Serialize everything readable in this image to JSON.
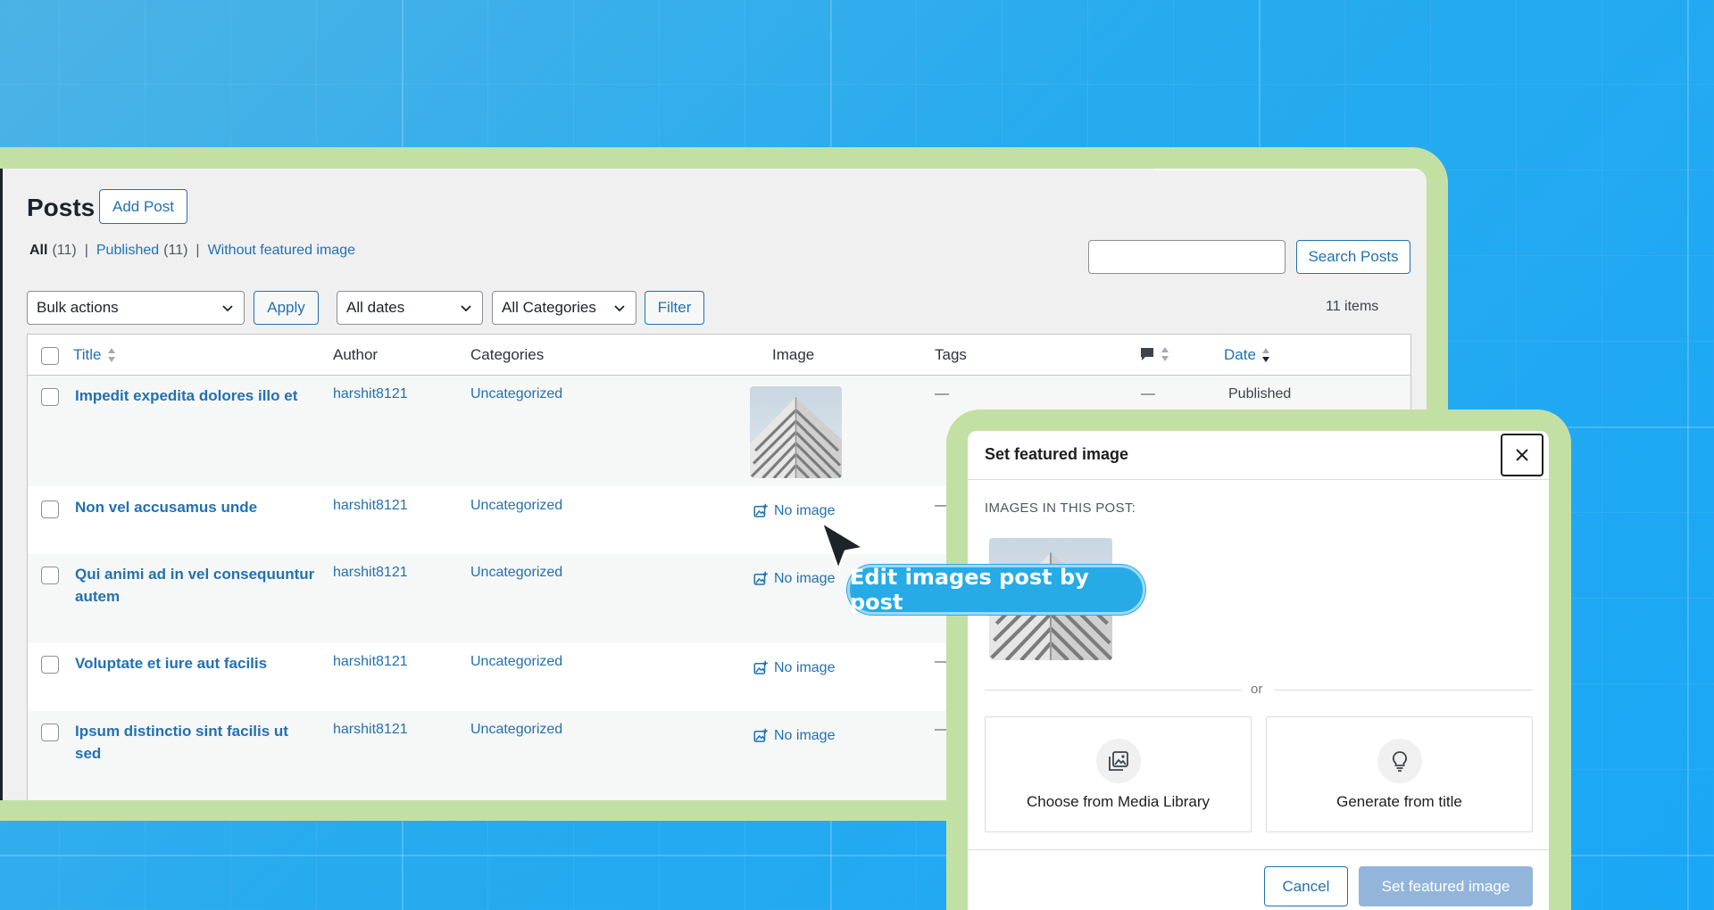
{
  "posts": {
    "title": "Posts",
    "add_label": "Add Post",
    "filters": {
      "all_label": "All",
      "all_count": "(11)",
      "published_label": "Published",
      "published_count": "(11)",
      "without_label": "Without featured image",
      "separator": "|"
    },
    "search_label": "Search Posts",
    "search_value": "",
    "bulk_label": "Bulk actions",
    "apply_label": "Apply",
    "dates_label": "All dates",
    "cats_label": "All Categories",
    "filter_label": "Filter",
    "items_count": "11 items",
    "columns": {
      "title": "Title",
      "author": "Author",
      "categories": "Categories",
      "image": "Image",
      "tags": "Tags",
      "date": "Date"
    },
    "no_image_label": "No image",
    "dash": "—",
    "rows": [
      {
        "title": "Impedit expedita dolores illo et",
        "author": "harshit8121",
        "category": "Uncategorized",
        "tags": "—",
        "comments": "—",
        "date": "Published",
        "has_image": true
      },
      {
        "title": "Non vel accusamus unde",
        "author": "harshit8121",
        "category": "Uncategorized",
        "tags": "—",
        "has_image": false
      },
      {
        "title": "Qui animi ad in vel consequuntur autem",
        "author": "harshit8121",
        "category": "Uncategorized",
        "has_image": false
      },
      {
        "title": "Voluptate et iure aut facilis",
        "author": "harshit8121",
        "category": "Uncategorized",
        "tags": "—",
        "has_image": false
      },
      {
        "title": "Ipsum distinctio sint facilis ut sed",
        "author": "harshit8121",
        "category": "Uncategorized",
        "tags": "—",
        "has_image": false
      }
    ]
  },
  "modal": {
    "title": "Set featured image",
    "section_label": "IMAGES IN THIS POST:",
    "or_label": "or",
    "choose_label": "Choose from Media Library",
    "generate_label": "Generate from title",
    "cancel_label": "Cancel",
    "set_label": "Set featured image"
  },
  "callout": {
    "text": "Edit images post by post"
  },
  "colors": {
    "background": "#27a9ec",
    "frame": "#c3e0a4",
    "link": "#2271b1",
    "disabled_button": "#93b5dc",
    "callout": "#27abe6"
  },
  "icons": {
    "no_image": "image-plus-icon",
    "media_library": "images-icon",
    "generate": "lightbulb-icon",
    "close": "close-icon",
    "comments": "comment-bubble-icon",
    "sort": "sort-arrows-icon",
    "chevron": "chevron-down-icon",
    "cursor": "mouse-pointer-icon"
  }
}
